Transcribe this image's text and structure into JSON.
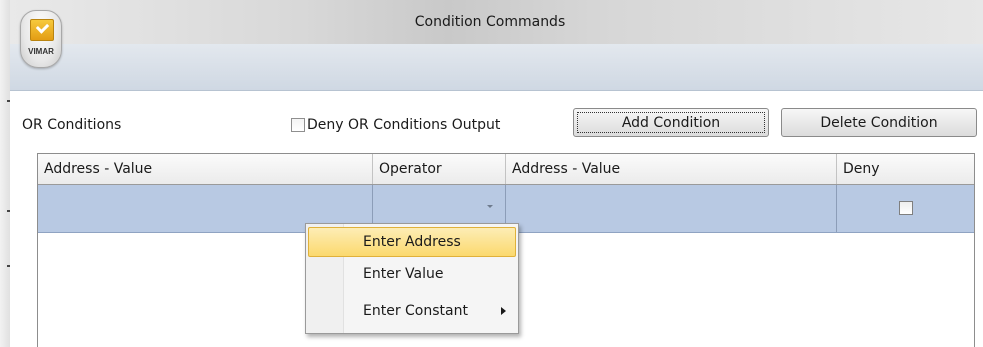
{
  "window": {
    "title": "Condition Commands",
    "app_logo_text": "VIMAR"
  },
  "panel": {
    "or_conditions_label": "OR Conditions",
    "deny_or_output_label": "Deny OR Conditions Output",
    "deny_or_output_checked": false,
    "add_condition_label": "Add Condition",
    "delete_condition_label": "Delete Condition"
  },
  "grid": {
    "columns": [
      "Address - Value",
      "Operator",
      "Address - Value",
      "Deny"
    ],
    "rows": [
      {
        "address_value_1": "",
        "operator": "",
        "address_value_2": "",
        "deny": false
      }
    ],
    "selected_row_color": "#b8c9e3"
  },
  "context_menu": {
    "items": [
      {
        "label": "Enter Address",
        "highlighted": true,
        "has_submenu": false
      },
      {
        "label": "Enter Value",
        "highlighted": false,
        "has_submenu": false
      },
      {
        "label": "Enter Constant",
        "highlighted": false,
        "has_submenu": true
      }
    ],
    "highlight_color": "#fbd96e"
  }
}
